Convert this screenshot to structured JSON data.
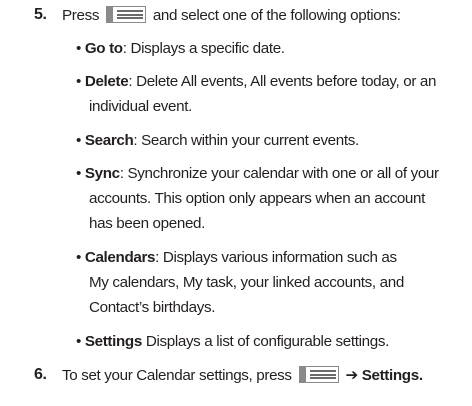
{
  "step5": {
    "number": "5.",
    "text_before": "Press",
    "text_after": "and select one of the following options:"
  },
  "menu_icon": "menu-key-icon",
  "bullets": [
    {
      "term": "Go to",
      "sep": ":",
      "lines": [
        " Displays a specific date."
      ]
    },
    {
      "term": "Delete",
      "sep": ":",
      "lines": [
        " Delete All events, All events before today, or an",
        "individual event."
      ]
    },
    {
      "term": "Search",
      "sep": ":",
      "lines": [
        " Search within your current events."
      ]
    },
    {
      "term": "Sync",
      "sep": ":",
      "lines": [
        " Synchronize your calendar with one or all of your",
        "accounts. This option only appears when an account",
        "has been opened."
      ]
    },
    {
      "term": "Calendars",
      "sep": ":",
      "lines": [
        " Displays various information such as",
        "My calendars, My task, your linked accounts, and",
        "Contact’s birthdays."
      ]
    },
    {
      "term": "Settings",
      "sep": "",
      "lines": [
        " Displays a list of configurable settings."
      ]
    }
  ],
  "bullet_char": "•",
  "step6": {
    "number": "6.",
    "text_before": "To set your Calendar settings, press",
    "arrow": "➔",
    "bold_end": "Settings",
    "period": "."
  }
}
